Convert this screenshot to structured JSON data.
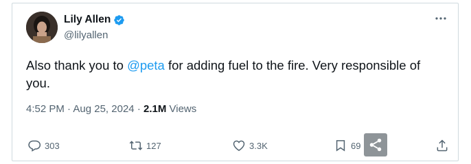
{
  "tweet": {
    "author": {
      "display_name": "Lily Allen",
      "handle": "@lilyallen",
      "verified": true,
      "avatar_icon": "profile-avatar"
    },
    "text_before": "Also thank you to ",
    "mention": "@peta",
    "text_after": " for adding fuel to the fire. Very responsible of you.",
    "time": "4:52 PM",
    "separator": "·",
    "date": "Aug 25, 2024",
    "views_count": "2.1M",
    "views_label": "Views"
  },
  "actions": {
    "replies": "303",
    "reposts": "127",
    "likes": "3.3K",
    "bookmarks": "69"
  },
  "colors": {
    "accent": "#1d9bf0",
    "text": "#0f1419",
    "secondary": "#536471",
    "border": "#cfd9de"
  }
}
